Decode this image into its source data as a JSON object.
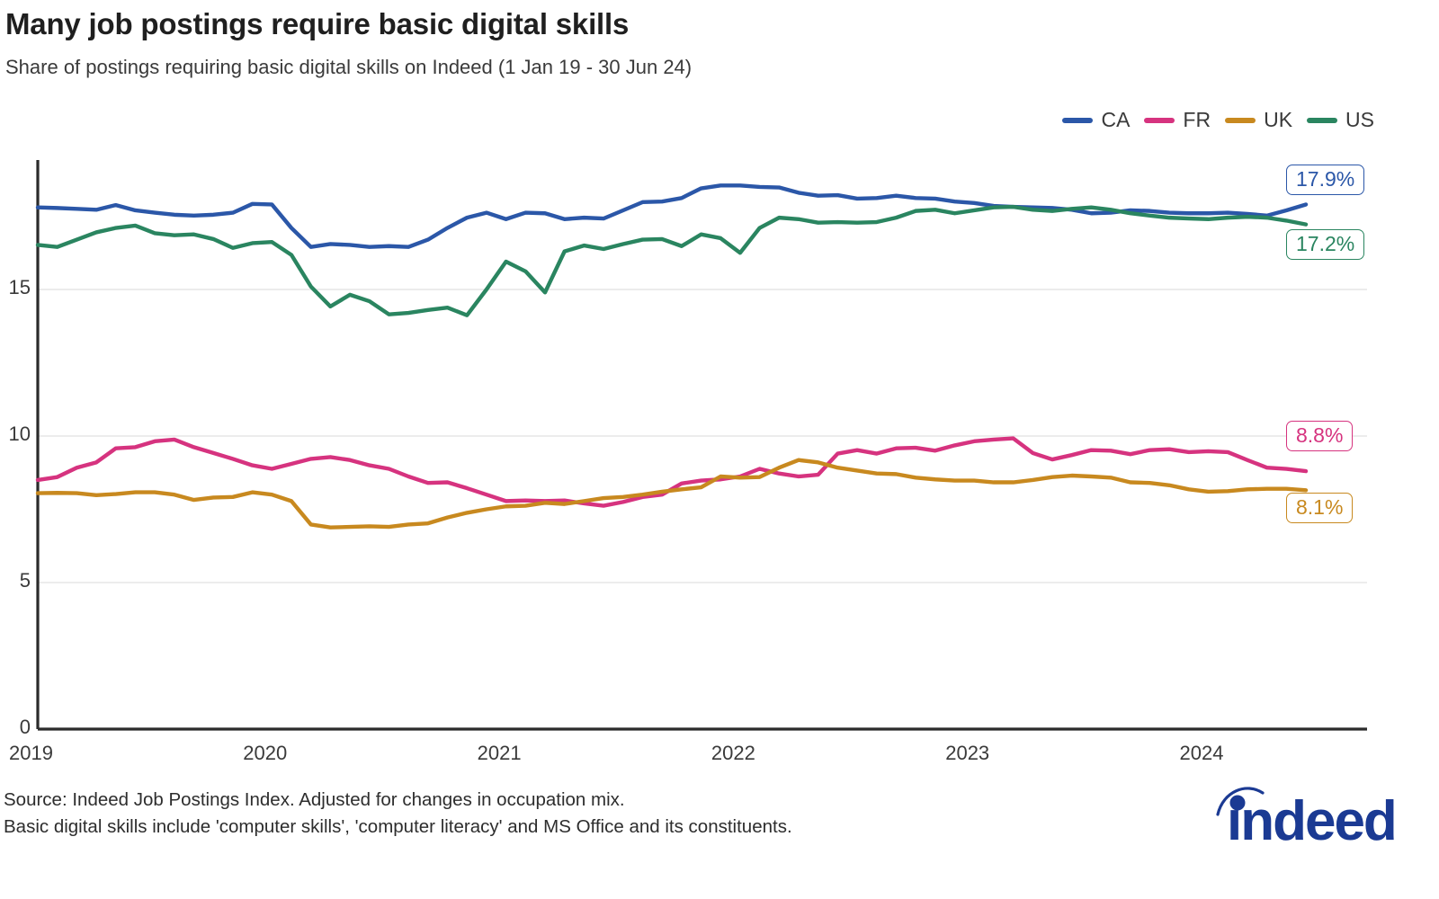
{
  "title": "Many job postings require basic digital skills",
  "subtitle": "Share of postings requiring basic digital skills on Indeed (1 Jan 19 - 30 Jun 24)",
  "footer": {
    "line1": "Source: Indeed Job Postings Index. Adjusted for changes in occupation mix.",
    "line2": "Basic digital skills include 'computer skills', 'computer literacy' and MS Office and its constituents."
  },
  "logo": {
    "name": "indeed-logo",
    "text": "indeed",
    "color": "#1B3A93"
  },
  "colors": {
    "CA": "#2B57A8",
    "FR": "#D6337F",
    "UK": "#C8891F",
    "US": "#2A8560",
    "grid": "#E6E6E6",
    "axis": "#2b2b2b"
  },
  "legend": {
    "position": "top-right",
    "items": [
      {
        "label": "CA",
        "color": "#2B57A8"
      },
      {
        "label": "FR",
        "color": "#D6337F"
      },
      {
        "label": "UK",
        "color": "#C8891F"
      },
      {
        "label": "US",
        "color": "#2A8560"
      }
    ]
  },
  "end_labels": [
    {
      "series": "CA",
      "text": "17.9%",
      "color": "#2B57A8"
    },
    {
      "series": "US",
      "text": "17.2%",
      "color": "#2A8560"
    },
    {
      "series": "FR",
      "text": "8.8%",
      "color": "#D6337F"
    },
    {
      "series": "UK",
      "text": "8.1%",
      "color": "#C8891F"
    }
  ],
  "chart_data": {
    "type": "line",
    "title": "Many job postings require basic digital skills",
    "subtitle": "Share of postings requiring basic digital skills on Indeed (1 Jan 19 - 30 Jun 24)",
    "xlabel": "",
    "ylabel": "",
    "ylim": [
      0,
      19.5
    ],
    "yticks": [
      0,
      5,
      10,
      15
    ],
    "ytick_labels": [
      "0",
      "5",
      "10",
      "15"
    ],
    "grid": "horizontal-only",
    "xticks": [
      "2019",
      "2020",
      "2021",
      "2022",
      "2023",
      "2024"
    ],
    "x_start": "2019-01",
    "x_end": "2024-06",
    "x_step_months": 1,
    "n_points": 66,
    "legend_position": "top-right",
    "series": [
      {
        "name": "CA",
        "color": "#2B57A8",
        "end_value": 17.9,
        "values": [
          17.8,
          17.78,
          17.75,
          17.72,
          17.88,
          17.7,
          17.62,
          17.55,
          17.52,
          17.55,
          17.62,
          17.92,
          17.9,
          17.1,
          16.45,
          16.55,
          16.52,
          16.45,
          16.48,
          16.45,
          16.7,
          17.1,
          17.45,
          17.62,
          17.4,
          17.62,
          17.6,
          17.4,
          17.45,
          17.42,
          17.7,
          17.98,
          18.0,
          18.12,
          18.45,
          18.55,
          18.55,
          18.5,
          18.48,
          18.3,
          18.2,
          18.22,
          18.1,
          18.12,
          18.2,
          18.12,
          18.1,
          18.0,
          17.95,
          17.85,
          17.82,
          17.8,
          17.78,
          17.72,
          17.6,
          17.62,
          17.7,
          17.68,
          17.62,
          17.6,
          17.6,
          17.62,
          17.58,
          17.52,
          17.7,
          17.9
        ]
      },
      {
        "name": "FR",
        "color": "#D6337F",
        "end_value": 8.8,
        "values": [
          8.5,
          8.6,
          8.92,
          9.1,
          9.58,
          9.62,
          9.82,
          9.88,
          9.62,
          9.42,
          9.22,
          9.0,
          8.88,
          9.05,
          9.22,
          9.28,
          9.18,
          9.0,
          8.88,
          8.62,
          8.4,
          8.42,
          8.22,
          8.0,
          7.78,
          7.8,
          7.78,
          7.8,
          7.7,
          7.62,
          7.75,
          7.92,
          8.0,
          8.38,
          8.48,
          8.52,
          8.62,
          8.88,
          8.72,
          8.62,
          8.68,
          9.4,
          9.52,
          9.4,
          9.58,
          9.6,
          9.5,
          9.68,
          9.82,
          9.88,
          9.92,
          9.42,
          9.2,
          9.35,
          9.52,
          9.5,
          9.38,
          9.52,
          9.55,
          9.45,
          9.48,
          9.45,
          9.18,
          8.92,
          8.88,
          8.8
        ]
      },
      {
        "name": "UK",
        "color": "#C8891F",
        "end_value": 8.1,
        "values": [
          8.05,
          8.06,
          8.05,
          7.98,
          8.02,
          8.08,
          8.08,
          8.0,
          7.82,
          7.9,
          7.92,
          8.08,
          8.0,
          7.78,
          6.98,
          6.88,
          6.9,
          6.92,
          6.9,
          6.98,
          7.02,
          7.22,
          7.38,
          7.5,
          7.6,
          7.62,
          7.72,
          7.68,
          7.78,
          7.88,
          7.92,
          8.0,
          8.1,
          8.18,
          8.25,
          8.62,
          8.58,
          8.6,
          8.92,
          9.18,
          9.1,
          8.92,
          8.82,
          8.72,
          8.7,
          8.58,
          8.52,
          8.48,
          8.48,
          8.42,
          8.42,
          8.5,
          8.6,
          8.65,
          8.62,
          8.58,
          8.42,
          8.4,
          8.32,
          8.18,
          8.1,
          8.12,
          8.18,
          8.2,
          8.2,
          8.15
        ]
      },
      {
        "name": "US",
        "color": "#2A8560",
        "end_value": 17.2,
        "values": [
          16.52,
          16.45,
          16.7,
          16.95,
          17.1,
          17.18,
          16.92,
          16.85,
          16.88,
          16.72,
          16.42,
          16.58,
          16.62,
          16.18,
          15.1,
          14.42,
          14.82,
          14.6,
          14.15,
          14.2,
          14.3,
          14.38,
          14.12,
          15.0,
          15.95,
          15.62,
          14.9,
          16.3,
          16.5,
          16.38,
          16.55,
          16.7,
          16.72,
          16.48,
          16.88,
          16.75,
          16.25,
          17.1,
          17.45,
          17.4,
          17.28,
          17.3,
          17.28,
          17.3,
          17.45,
          17.68,
          17.72,
          17.6,
          17.7,
          17.8,
          17.82,
          17.72,
          17.68,
          17.75,
          17.8,
          17.72,
          17.6,
          17.52,
          17.45,
          17.42,
          17.4,
          17.45,
          17.48,
          17.45,
          17.35,
          17.22
        ]
      }
    ]
  }
}
